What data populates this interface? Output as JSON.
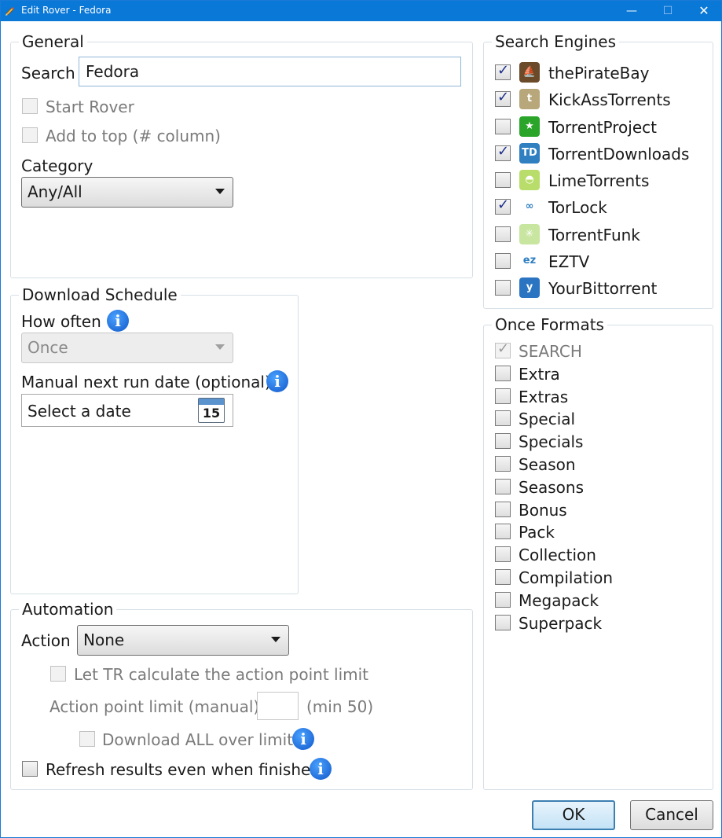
{
  "window": {
    "title": "Edit Rover - Fedora",
    "minimize": "—",
    "maximize": "☐",
    "close": "✕"
  },
  "general": {
    "legend": "General",
    "search_label": "Search",
    "search_value": "Fedora",
    "start_rover_label": "Start Rover",
    "add_to_top_label": "Add to top (# column)",
    "category_label": "Category",
    "category_value": "Any/All"
  },
  "schedule": {
    "legend": "Download Schedule",
    "how_often_label": "How often",
    "how_often_value": "Once",
    "manual_date_label": "Manual next run date (optional)",
    "date_placeholder": "Select a date",
    "calendar_day": "15"
  },
  "automation": {
    "legend": "Automation",
    "action_label": "Action",
    "action_value": "None",
    "let_tr_label": "Let TR calculate the action point limit",
    "point_limit_label": "Action point limit (manual)",
    "point_limit_hint": "(min 50)",
    "download_all_label": "Download ALL over limit",
    "refresh_label": "Refresh results even when finished"
  },
  "search_engines": {
    "legend": "Search Engines",
    "items": [
      {
        "label": "thePirateBay",
        "checked": true,
        "icon": "pirate-ship-icon",
        "icon_glyph": "⛵",
        "color": "#6b4a2a"
      },
      {
        "label": "KickAssTorrents",
        "checked": true,
        "icon": "kat-shield-icon",
        "icon_glyph": "t",
        "color": "#b8a77a"
      },
      {
        "label": "TorrentProject",
        "checked": false,
        "icon": "green-star-icon",
        "icon_glyph": "★",
        "color": "#2aa52a"
      },
      {
        "label": "TorrentDownloads",
        "checked": true,
        "icon": "td-logo-icon",
        "icon_glyph": "TD",
        "color": "#2f7fc1"
      },
      {
        "label": "LimeTorrents",
        "checked": false,
        "icon": "lime-icon",
        "icon_glyph": "◓",
        "color": "#b9dd6a"
      },
      {
        "label": "TorLock",
        "checked": true,
        "icon": "torlock-icon",
        "icon_glyph": "∞",
        "color": "#ffffff"
      },
      {
        "label": "TorrentFunk",
        "checked": false,
        "icon": "torrentfunk-icon",
        "icon_glyph": "✳",
        "color": "#c8e6a0"
      },
      {
        "label": "EZTV",
        "checked": false,
        "icon": "eztv-icon",
        "icon_glyph": "ez",
        "color": "#ffffff"
      },
      {
        "label": "YourBittorrent",
        "checked": false,
        "icon": "yourbittorrent-icon",
        "icon_glyph": "y",
        "color": "#2a74c2"
      }
    ]
  },
  "once_formats": {
    "legend": "Once Formats",
    "items": [
      {
        "label": "SEARCH",
        "checked": true,
        "disabled": true
      },
      {
        "label": "Extra",
        "checked": false,
        "disabled": false
      },
      {
        "label": "Extras",
        "checked": false,
        "disabled": false
      },
      {
        "label": "Special",
        "checked": false,
        "disabled": false
      },
      {
        "label": "Specials",
        "checked": false,
        "disabled": false
      },
      {
        "label": "Season",
        "checked": false,
        "disabled": false
      },
      {
        "label": "Seasons",
        "checked": false,
        "disabled": false
      },
      {
        "label": "Bonus",
        "checked": false,
        "disabled": false
      },
      {
        "label": "Pack",
        "checked": false,
        "disabled": false
      },
      {
        "label": "Collection",
        "checked": false,
        "disabled": false
      },
      {
        "label": "Compilation",
        "checked": false,
        "disabled": false
      },
      {
        "label": "Megapack",
        "checked": false,
        "disabled": false
      },
      {
        "label": "Superpack",
        "checked": false,
        "disabled": false
      }
    ]
  },
  "buttons": {
    "ok": "OK",
    "cancel": "Cancel"
  },
  "info_glyph": "i",
  "check_glyph": "✓"
}
